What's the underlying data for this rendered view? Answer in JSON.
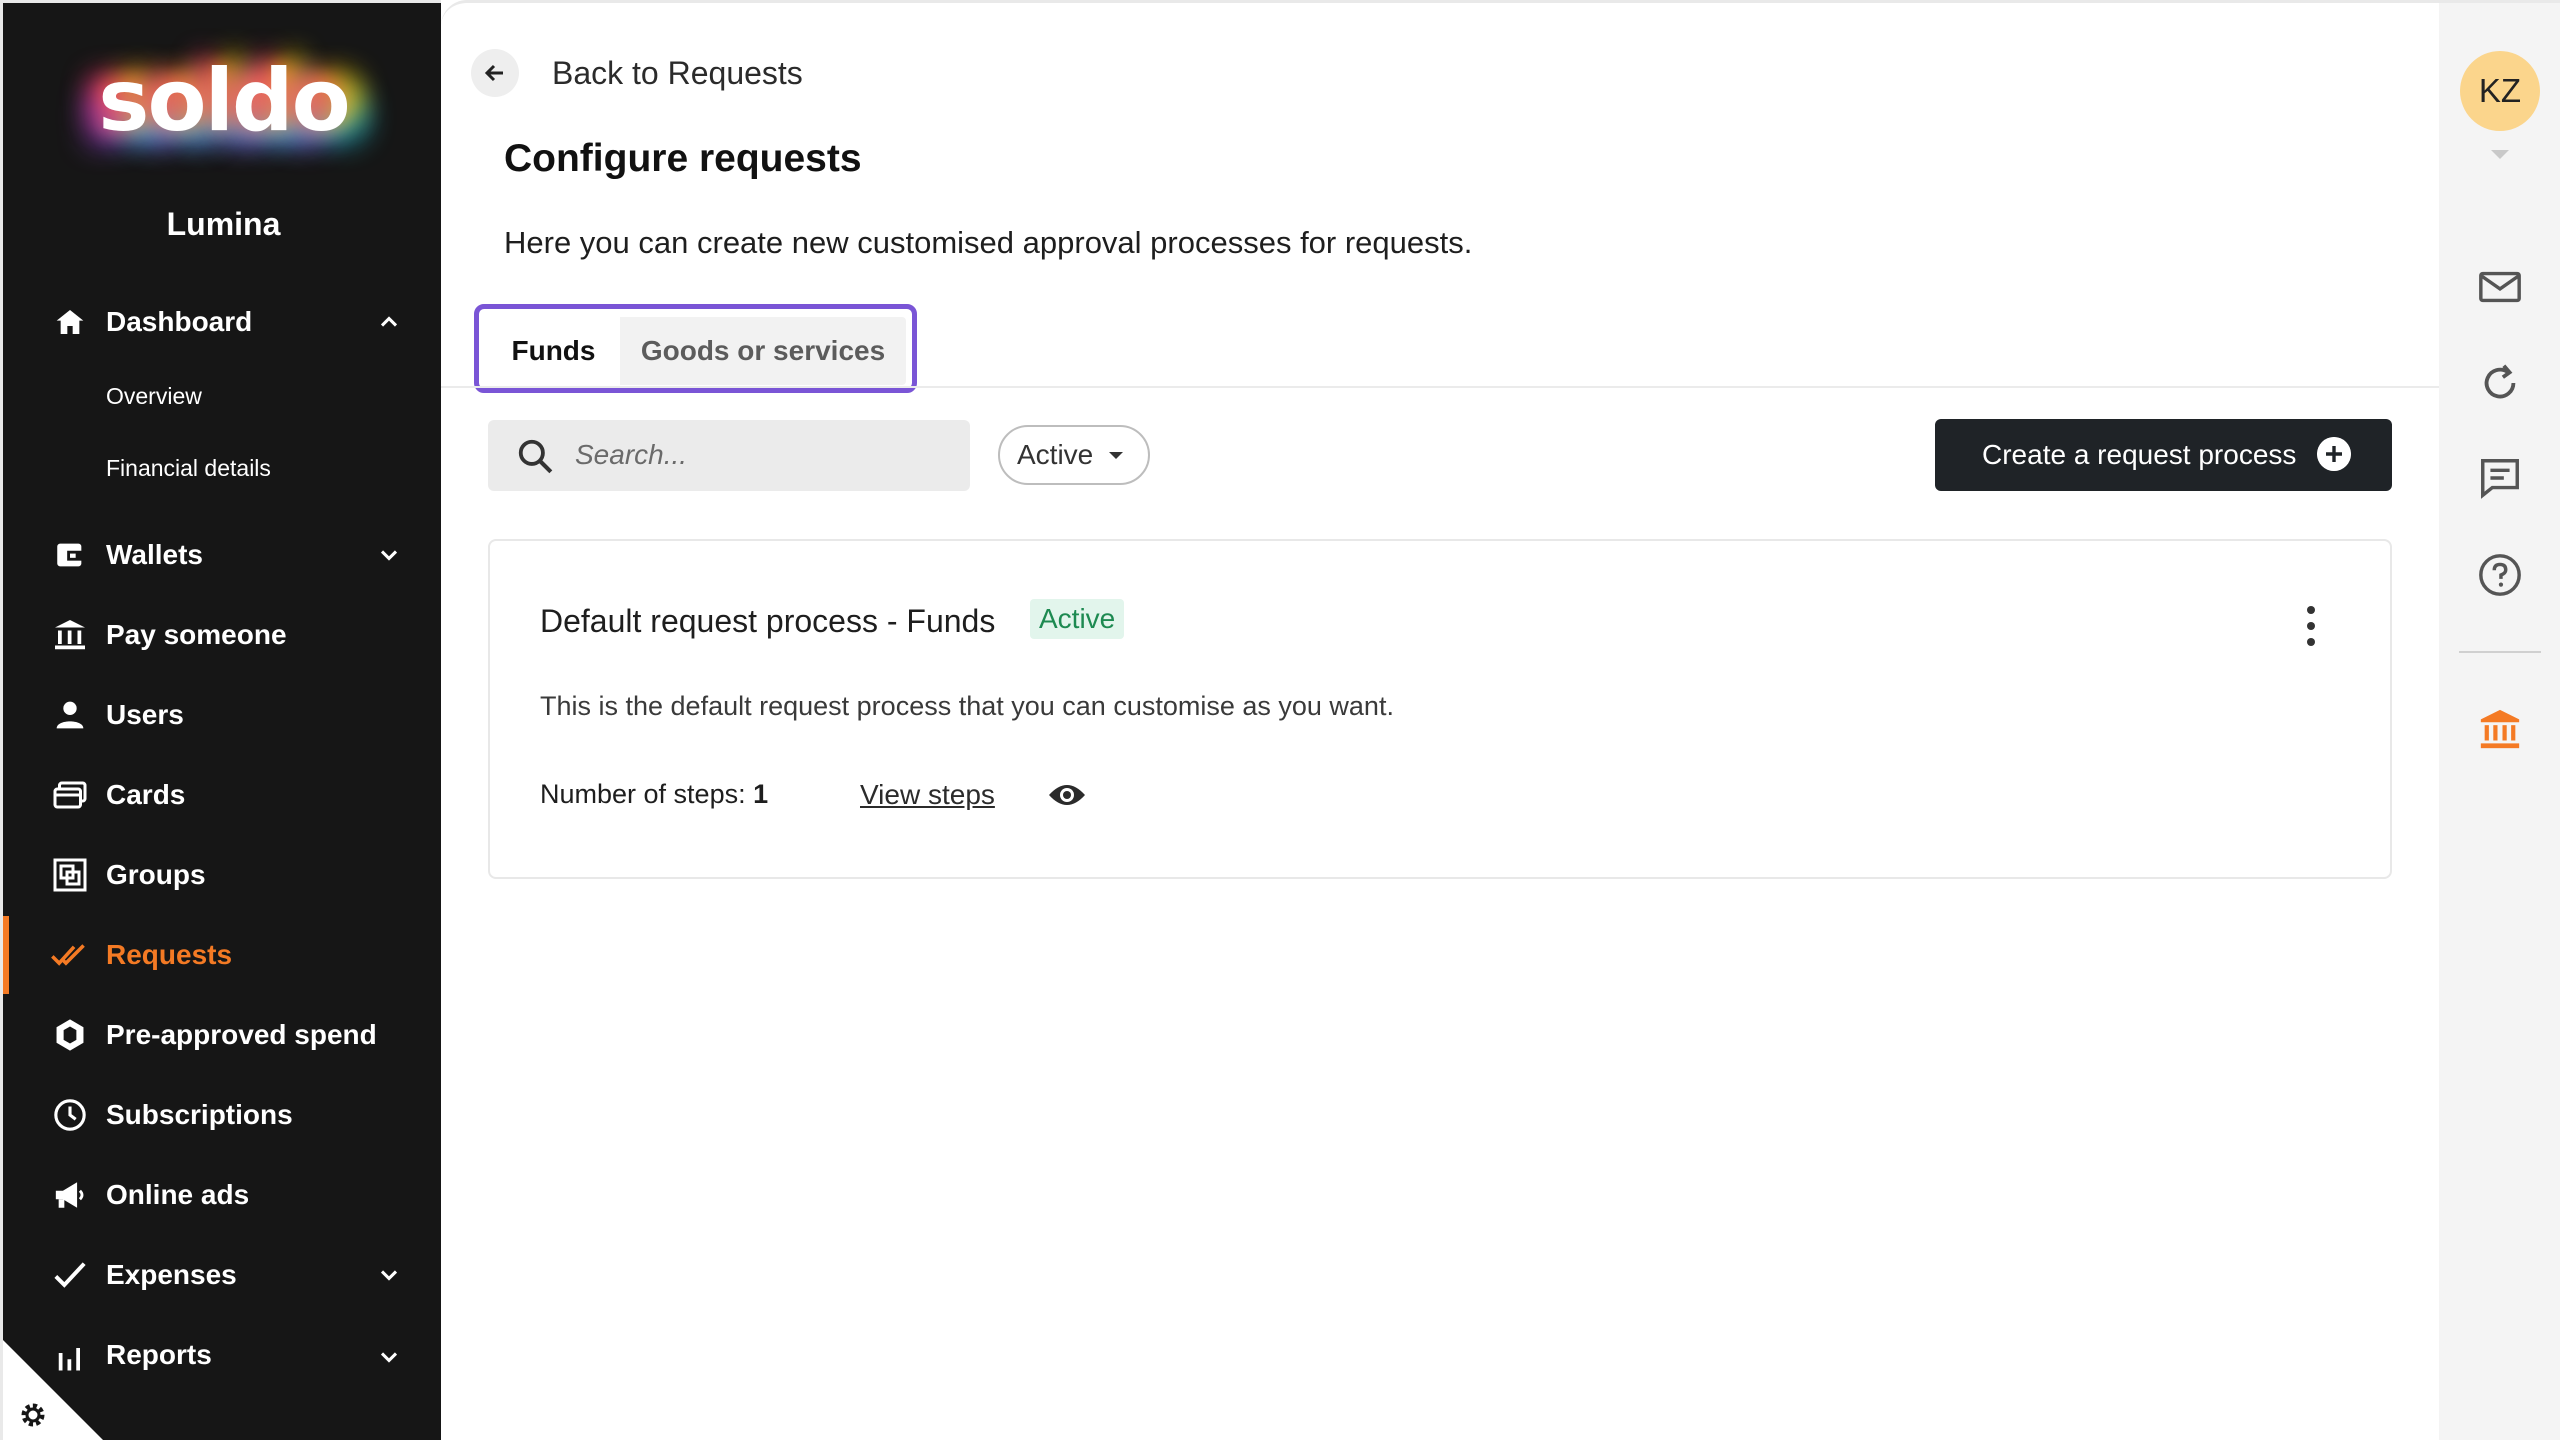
{
  "brand": {
    "logo_text": "soldo",
    "org_name": "Lumina",
    "accent": "#f47a24"
  },
  "sidebar": {
    "items": [
      {
        "key": "dashboard",
        "label": "Dashboard",
        "icon": "home-icon",
        "expanded": true,
        "children": [
          {
            "label": "Overview"
          },
          {
            "label": "Financial details"
          }
        ]
      },
      {
        "key": "wallets",
        "label": "Wallets",
        "icon": "wallet-icon",
        "expandable": true
      },
      {
        "key": "pay",
        "label": "Pay someone",
        "icon": "bank-transfer-icon"
      },
      {
        "key": "users",
        "label": "Users",
        "icon": "user-icon"
      },
      {
        "key": "cards",
        "label": "Cards",
        "icon": "cards-icon"
      },
      {
        "key": "groups",
        "label": "Groups",
        "icon": "groups-icon"
      },
      {
        "key": "requests",
        "label": "Requests",
        "icon": "double-check-icon",
        "active": true
      },
      {
        "key": "preapproved",
        "label": "Pre-approved spend",
        "icon": "hexagon-icon"
      },
      {
        "key": "subscriptions",
        "label": "Subscriptions",
        "icon": "clock-icon"
      },
      {
        "key": "ads",
        "label": "Online ads",
        "icon": "megaphone-icon"
      },
      {
        "key": "expenses",
        "label": "Expenses",
        "icon": "check-icon",
        "expandable": true
      },
      {
        "key": "reports",
        "label": "Reports",
        "icon": "bar-chart-icon",
        "expandable": true
      }
    ]
  },
  "header": {
    "back_label": "Back to Requests"
  },
  "page": {
    "title": "Configure requests",
    "description": "Here you can create new customised approval processes for requests.",
    "tabs": [
      {
        "label": "Funds",
        "selected": true
      },
      {
        "label": "Goods or services",
        "selected": false
      }
    ]
  },
  "toolbar": {
    "search_placeholder": "Search...",
    "filter_value": "Active",
    "create_label": "Create a request process"
  },
  "processes": [
    {
      "title": "Default request process - Funds",
      "status": "Active",
      "description": "This is the default request process that you can customise as you want.",
      "steps_label": "Number of steps:",
      "steps_count": "1",
      "view_steps_label": "View steps"
    }
  ],
  "user": {
    "initials": "KZ"
  },
  "rightbar": {
    "icons": [
      "mail-icon",
      "refresh-icon",
      "chat-icon",
      "help-icon",
      "bank-icon"
    ]
  }
}
